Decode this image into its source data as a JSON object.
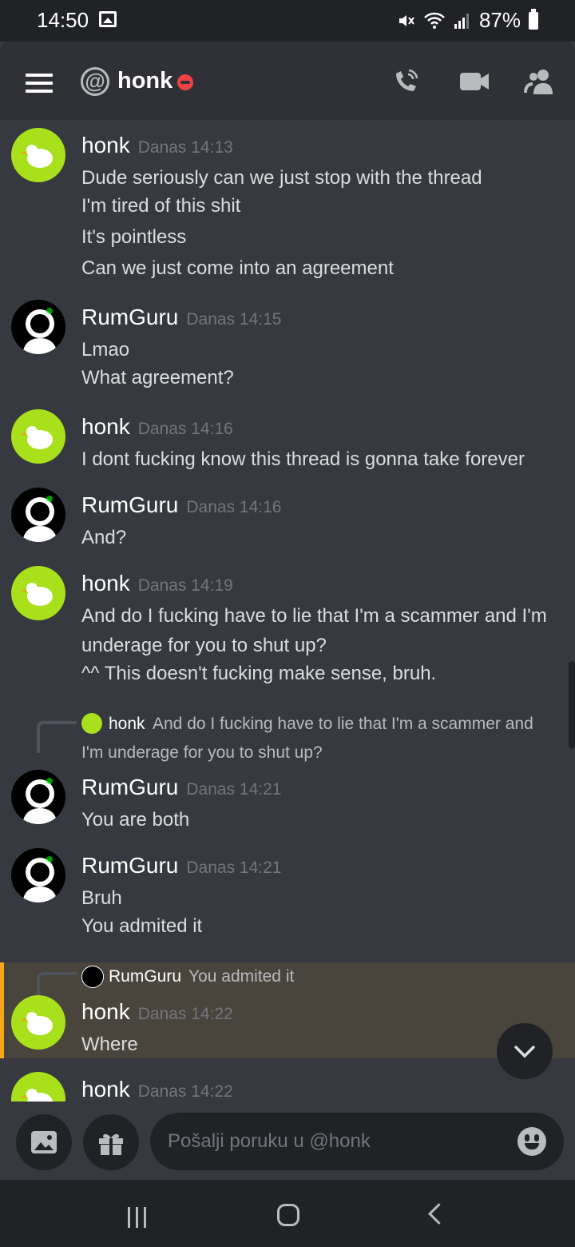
{
  "status_bar": {
    "time": "14:50",
    "battery": "87%"
  },
  "header": {
    "at_symbol": "@",
    "title": "honk",
    "status": "do-not-disturb"
  },
  "messages": [
    {
      "author": "honk",
      "timestamp": "Danas 14:13",
      "lines": [
        "Dude seriously can we just stop with the thread",
        "I'm tired of this shit",
        "It's pointless",
        "Can we just come into an agreement"
      ]
    },
    {
      "author": "RumGuru",
      "timestamp": "Danas 14:15",
      "lines": [
        "Lmao",
        "What agreement?"
      ]
    },
    {
      "author": "honk",
      "timestamp": "Danas 14:16",
      "lines": [
        "I dont fucking know this thread is gonna take forever"
      ]
    },
    {
      "author": "RumGuru",
      "timestamp": "Danas 14:16",
      "lines": [
        "And?"
      ]
    },
    {
      "author": "honk",
      "timestamp": "Danas 14:19",
      "lines": [
        "And do I fucking have to lie that I'm a scammer and I'm",
        "underage for you to shut up?",
        "^^ This doesn't fucking make sense, bruh."
      ]
    },
    {
      "author": "RumGuru",
      "timestamp": "Danas 14:21",
      "lines": [
        "You are both"
      ],
      "reply": {
        "author": "honk",
        "text_line1": "And do I fucking have to lie that I'm a scammer and",
        "text_line2": "I'm underage for you to shut up?"
      }
    },
    {
      "author": "RumGuru",
      "timestamp": "Danas 14:21",
      "lines": [
        "Bruh",
        "You admited it"
      ]
    },
    {
      "author": "honk",
      "timestamp": "Danas 14:22",
      "lines": [
        "Where"
      ],
      "reply": {
        "author": "RumGuru",
        "text_line1": "You admited it"
      },
      "highlighted": true
    },
    {
      "author": "honk",
      "timestamp": "Danas 14:22",
      "lines": []
    }
  ],
  "composer": {
    "placeholder": "Pošalji poruku u @honk"
  },
  "icons": {
    "menu": "hamburger-icon",
    "at": "at-icon",
    "call": "phone-call-icon",
    "video": "video-camera-icon",
    "members": "members-icon",
    "image": "image-icon",
    "gift": "gift-icon",
    "emoji": "emoji-icon",
    "scroll_down": "chevron-down-icon"
  },
  "colors": {
    "background": "#36393f",
    "header": "#2f3136",
    "dark": "#202225",
    "highlight": "#49443c",
    "accent_bar": "#faa61a",
    "dnd": "#ed4245",
    "honk_avatar": "#a8e01b"
  }
}
